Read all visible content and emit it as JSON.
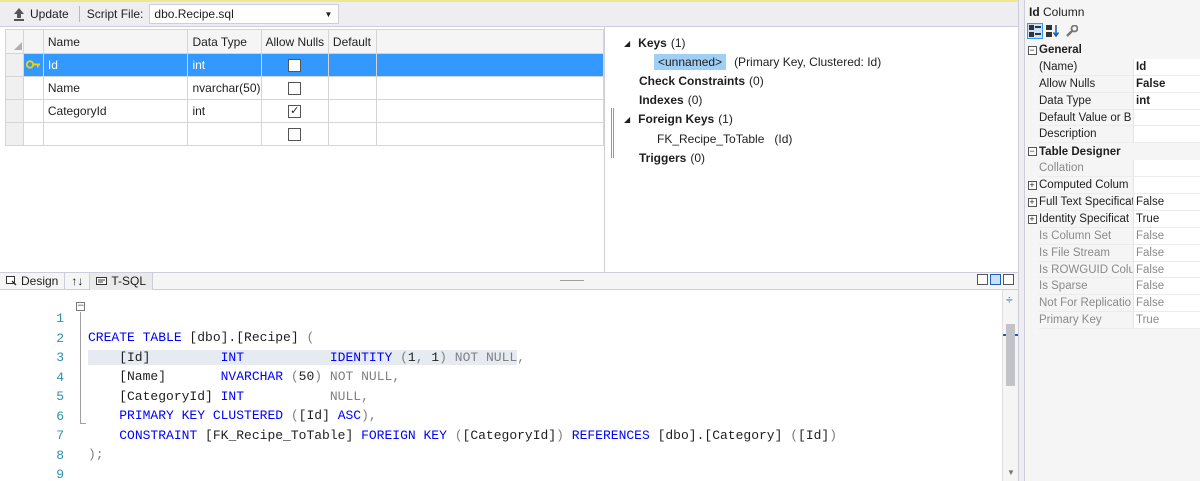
{
  "toolbar": {
    "update_label": "Update",
    "script_file_label": "Script File:",
    "script_file_value": "dbo.Recipe.sql"
  },
  "grid": {
    "headers": [
      "Name",
      "Data Type",
      "Allow Nulls",
      "Default"
    ],
    "rows": [
      {
        "name": "Id",
        "type": "int",
        "allow_nulls": false,
        "default": "",
        "primary_key": true,
        "selected": true
      },
      {
        "name": "Name",
        "type": "nvarchar(50)",
        "allow_nulls": false,
        "default": ""
      },
      {
        "name": "CategoryId",
        "type": "int",
        "allow_nulls": true,
        "default": ""
      },
      {
        "name": "",
        "type": "",
        "allow_nulls": false,
        "default": ""
      }
    ]
  },
  "keys_panel": {
    "keys_label": "Keys",
    "keys_count": "(1)",
    "key_name": "<unnamed>",
    "key_desc": "(Primary Key, Clustered: Id)",
    "check_label": "Check Constraints",
    "check_count": "(0)",
    "indexes_label": "Indexes",
    "indexes_count": "(0)",
    "fk_label": "Foreign Keys",
    "fk_count": "(1)",
    "fk_name": "FK_Recipe_ToTable",
    "fk_desc": "(Id)",
    "triggers_label": "Triggers",
    "triggers_count": "(0)"
  },
  "tabs": {
    "design": "Design",
    "swap": "↑↓",
    "tsql": "T-SQL"
  },
  "editor": {
    "line_numbers": [
      "1",
      "2",
      "3",
      "4",
      "5",
      "6",
      "7",
      "8",
      "9"
    ]
  },
  "properties": {
    "title_bold": "Id",
    "title_rest": "Column",
    "rows": [
      {
        "kind": "cat",
        "sign": "-",
        "name": "General"
      },
      {
        "kind": "prop",
        "name": "(Name)",
        "value": "Id",
        "bold": true
      },
      {
        "kind": "prop",
        "name": "Allow Nulls",
        "value": "False",
        "bold": true
      },
      {
        "kind": "prop",
        "name": "Data Type",
        "value": "int",
        "bold": true
      },
      {
        "kind": "prop",
        "name": "Default Value or B",
        "value": ""
      },
      {
        "kind": "prop",
        "name": "Description",
        "value": ""
      },
      {
        "kind": "cat",
        "sign": "-",
        "name": "Table Designer"
      },
      {
        "kind": "prop",
        "name": "Collation",
        "value": "",
        "dim": true
      },
      {
        "kind": "prop",
        "name": "Computed Colum",
        "value": "",
        "sign": "+"
      },
      {
        "kind": "prop",
        "name": "Full Text Specificat",
        "value": "False",
        "sign": "+"
      },
      {
        "kind": "prop",
        "name": "Identity Specificat",
        "value": "True",
        "sign": "+"
      },
      {
        "kind": "prop",
        "name": "Is Column Set",
        "value": "False",
        "dim": true
      },
      {
        "kind": "prop",
        "name": "Is File Stream",
        "value": "False",
        "dim": true
      },
      {
        "kind": "prop",
        "name": "Is ROWGUID Colu",
        "value": "False",
        "dim": true
      },
      {
        "kind": "prop",
        "name": "Is Sparse",
        "value": "False",
        "dim": true
      },
      {
        "kind": "prop",
        "name": "Not For Replicatio",
        "value": "False",
        "dim": true
      },
      {
        "kind": "prop",
        "name": "Primary Key",
        "value": "True",
        "dim": true
      }
    ]
  },
  "colors": {
    "selection": "#3399ff",
    "keyword": "#0000ff",
    "gray": "#808080",
    "magenta": "#ff00ff",
    "line_number": "#2b91af",
    "key_highlight": "#9fcff5"
  },
  "icons": [
    "update-arrow-icon",
    "primary-key-icon",
    "checkmark-icon",
    "design-icon",
    "tsql-icon",
    "categorized-icon",
    "alphabetical-icon",
    "property-pages-icon"
  ]
}
